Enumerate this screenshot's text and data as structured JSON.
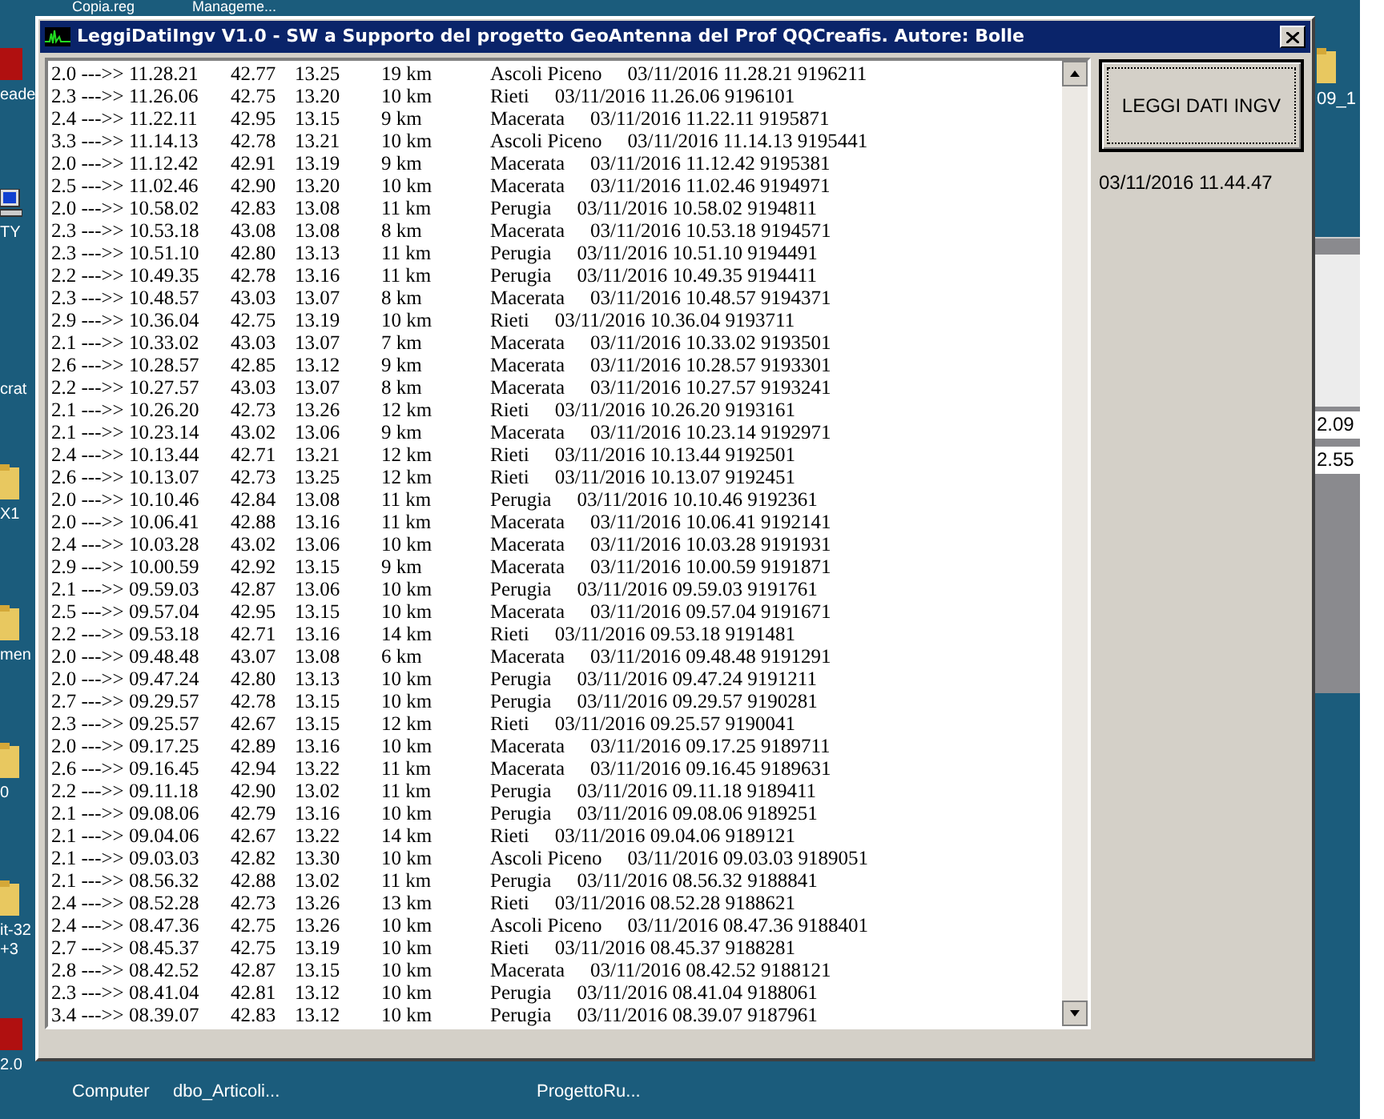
{
  "desktop": {
    "icons": [
      {
        "kind": "none",
        "label": "Copia.reg"
      },
      {
        "kind": "none",
        "label": "Manageme..."
      },
      {
        "kind": "app",
        "label": "eade"
      },
      {
        "kind": "computer",
        "label": "TY"
      },
      {
        "kind": "none",
        "label": "crat"
      },
      {
        "kind": "folder",
        "label": "X1"
      },
      {
        "kind": "folder",
        "label": "men"
      },
      {
        "kind": "folder",
        "label": "0"
      },
      {
        "kind": "folder",
        "label": "it-32\n+3"
      },
      {
        "kind": "app",
        "label": "2.0"
      },
      {
        "kind": "none",
        "label": "Computer"
      },
      {
        "kind": "none",
        "label": "dbo_Articoli..."
      },
      {
        "kind": "none",
        "label": "ProgettoRu..."
      },
      {
        "kind": "folder",
        "label": "09_1"
      }
    ]
  },
  "background_window": {
    "fields": [
      "2.09",
      "2.55"
    ]
  },
  "window": {
    "title": "LeggiDatiIngv V1.0 - SW a Supporto del progetto GeoAntenna del Prof QQCreafis.  Autore: Bolle",
    "rows": [
      {
        "event": "2.0 --->> 11.28.21",
        "lat": "42.77",
        "lon": "13.25",
        "depth": "19 km",
        "place": "Ascoli Piceno",
        "stamp": "03/11/2016 11.28.21 9196211"
      },
      {
        "event": "2.3 --->> 11.26.06",
        "lat": "42.75",
        "lon": "13.20",
        "depth": "10 km",
        "place": "Rieti",
        "stamp": "03/11/2016 11.26.06 9196101"
      },
      {
        "event": "2.4 --->> 11.22.11",
        "lat": "42.95",
        "lon": "13.15",
        "depth": "9 km",
        "place": "Macerata",
        "stamp": "03/11/2016 11.22.11 9195871"
      },
      {
        "event": "3.3 --->> 11.14.13",
        "lat": "42.78",
        "lon": "13.21",
        "depth": "10 km",
        "place": "Ascoli Piceno",
        "stamp": "03/11/2016 11.14.13 9195441"
      },
      {
        "event": "2.0 --->> 11.12.42",
        "lat": "42.91",
        "lon": "13.19",
        "depth": "9 km",
        "place": "Macerata",
        "stamp": "03/11/2016 11.12.42 9195381"
      },
      {
        "event": "2.5 --->> 11.02.46",
        "lat": "42.90",
        "lon": "13.20",
        "depth": "10 km",
        "place": "Macerata",
        "stamp": "03/11/2016 11.02.46 9194971"
      },
      {
        "event": "2.0 --->> 10.58.02",
        "lat": "42.83",
        "lon": "13.08",
        "depth": "11 km",
        "place": "Perugia",
        "stamp": "03/11/2016 10.58.02 9194811"
      },
      {
        "event": "2.3 --->> 10.53.18",
        "lat": "43.08",
        "lon": "13.08",
        "depth": "8 km",
        "place": "Macerata",
        "stamp": "03/11/2016 10.53.18 9194571"
      },
      {
        "event": "2.3 --->> 10.51.10",
        "lat": "42.80",
        "lon": "13.13",
        "depth": "11 km",
        "place": "Perugia",
        "stamp": "03/11/2016 10.51.10 9194491"
      },
      {
        "event": "2.2 --->> 10.49.35",
        "lat": "42.78",
        "lon": "13.16",
        "depth": "11 km",
        "place": "Perugia",
        "stamp": "03/11/2016 10.49.35 9194411"
      },
      {
        "event": "2.3 --->> 10.48.57",
        "lat": "43.03",
        "lon": "13.07",
        "depth": "8 km",
        "place": "Macerata",
        "stamp": "03/11/2016 10.48.57 9194371"
      },
      {
        "event": "2.9 --->> 10.36.04",
        "lat": "42.75",
        "lon": "13.19",
        "depth": "10 km",
        "place": "Rieti",
        "stamp": "03/11/2016 10.36.04 9193711"
      },
      {
        "event": "2.1 --->> 10.33.02",
        "lat": "43.03",
        "lon": "13.07",
        "depth": "7 km",
        "place": "Macerata",
        "stamp": "03/11/2016 10.33.02 9193501"
      },
      {
        "event": "2.6 --->> 10.28.57",
        "lat": "42.85",
        "lon": "13.12",
        "depth": "9 km",
        "place": "Macerata",
        "stamp": "03/11/2016 10.28.57 9193301"
      },
      {
        "event": "2.2 --->> 10.27.57",
        "lat": "43.03",
        "lon": "13.07",
        "depth": "8 km",
        "place": "Macerata",
        "stamp": "03/11/2016 10.27.57 9193241"
      },
      {
        "event": "2.1 --->> 10.26.20",
        "lat": "42.73",
        "lon": "13.26",
        "depth": "12 km",
        "place": "Rieti",
        "stamp": "03/11/2016 10.26.20 9193161"
      },
      {
        "event": "2.1 --->> 10.23.14",
        "lat": "43.02",
        "lon": "13.06",
        "depth": "9 km",
        "place": "Macerata",
        "stamp": "03/11/2016 10.23.14 9192971"
      },
      {
        "event": "2.4 --->> 10.13.44",
        "lat": "42.71",
        "lon": "13.21",
        "depth": "12 km",
        "place": "Rieti",
        "stamp": "03/11/2016 10.13.44 9192501"
      },
      {
        "event": "2.6 --->> 10.13.07",
        "lat": "42.73",
        "lon": "13.25",
        "depth": "12 km",
        "place": "Rieti",
        "stamp": "03/11/2016 10.13.07 9192451"
      },
      {
        "event": "2.0 --->> 10.10.46",
        "lat": "42.84",
        "lon": "13.08",
        "depth": "11 km",
        "place": "Perugia",
        "stamp": "03/11/2016 10.10.46 9192361"
      },
      {
        "event": "2.0 --->> 10.06.41",
        "lat": "42.88",
        "lon": "13.16",
        "depth": "11 km",
        "place": "Macerata",
        "stamp": "03/11/2016 10.06.41 9192141"
      },
      {
        "event": "2.4 --->> 10.03.28",
        "lat": "43.02",
        "lon": "13.06",
        "depth": "10 km",
        "place": "Macerata",
        "stamp": "03/11/2016 10.03.28 9191931"
      },
      {
        "event": "2.9 --->> 10.00.59",
        "lat": "42.92",
        "lon": "13.15",
        "depth": "9 km",
        "place": "Macerata",
        "stamp": "03/11/2016 10.00.59 9191871"
      },
      {
        "event": "2.1 --->> 09.59.03",
        "lat": "42.87",
        "lon": "13.06",
        "depth": "10 km",
        "place": "Perugia",
        "stamp": "03/11/2016 09.59.03 9191761"
      },
      {
        "event": "2.5 --->> 09.57.04",
        "lat": "42.95",
        "lon": "13.15",
        "depth": "10 km",
        "place": "Macerata",
        "stamp": "03/11/2016 09.57.04 9191671"
      },
      {
        "event": "2.2 --->> 09.53.18",
        "lat": "42.71",
        "lon": "13.16",
        "depth": "14 km",
        "place": "Rieti",
        "stamp": "03/11/2016 09.53.18 9191481"
      },
      {
        "event": "2.0 --->> 09.48.48",
        "lat": "43.07",
        "lon": "13.08",
        "depth": "6 km",
        "place": "Macerata",
        "stamp": "03/11/2016 09.48.48 9191291"
      },
      {
        "event": "2.0 --->> 09.47.24",
        "lat": "42.80",
        "lon": "13.13",
        "depth": "10 km",
        "place": "Perugia",
        "stamp": "03/11/2016 09.47.24 9191211"
      },
      {
        "event": "2.7 --->> 09.29.57",
        "lat": "42.78",
        "lon": "13.15",
        "depth": "10 km",
        "place": "Perugia",
        "stamp": "03/11/2016 09.29.57 9190281"
      },
      {
        "event": "2.3 --->> 09.25.57",
        "lat": "42.67",
        "lon": "13.15",
        "depth": "12 km",
        "place": "Rieti",
        "stamp": "03/11/2016 09.25.57 9190041"
      },
      {
        "event": "2.0 --->> 09.17.25",
        "lat": "42.89",
        "lon": "13.16",
        "depth": "10 km",
        "place": "Macerata",
        "stamp": "03/11/2016 09.17.25 9189711"
      },
      {
        "event": "2.6 --->> 09.16.45",
        "lat": "42.94",
        "lon": "13.22",
        "depth": "11 km",
        "place": "Macerata",
        "stamp": "03/11/2016 09.16.45 9189631"
      },
      {
        "event": "2.2 --->> 09.11.18",
        "lat": "42.90",
        "lon": "13.02",
        "depth": "11 km",
        "place": "Perugia",
        "stamp": "03/11/2016 09.11.18 9189411"
      },
      {
        "event": "2.1 --->> 09.08.06",
        "lat": "42.79",
        "lon": "13.16",
        "depth": "10 km",
        "place": "Perugia",
        "stamp": "03/11/2016 09.08.06 9189251"
      },
      {
        "event": "2.1 --->> 09.04.06",
        "lat": "42.67",
        "lon": "13.22",
        "depth": "14 km",
        "place": "Rieti",
        "stamp": "03/11/2016 09.04.06 9189121"
      },
      {
        "event": "2.1 --->> 09.03.03",
        "lat": "42.82",
        "lon": "13.30",
        "depth": "10 km",
        "place": "Ascoli Piceno",
        "stamp": "03/11/2016 09.03.03 9189051"
      },
      {
        "event": "2.1 --->> 08.56.32",
        "lat": "42.88",
        "lon": "13.02",
        "depth": "11 km",
        "place": "Perugia",
        "stamp": "03/11/2016 08.56.32 9188841"
      },
      {
        "event": "2.4 --->> 08.52.28",
        "lat": "42.73",
        "lon": "13.26",
        "depth": "13 km",
        "place": "Rieti",
        "stamp": "03/11/2016 08.52.28 9188621"
      },
      {
        "event": "2.4 --->> 08.47.36",
        "lat": "42.75",
        "lon": "13.26",
        "depth": "10 km",
        "place": "Ascoli Piceno",
        "stamp": "03/11/2016 08.47.36 9188401"
      },
      {
        "event": "2.7 --->> 08.45.37",
        "lat": "42.75",
        "lon": "13.19",
        "depth": "10 km",
        "place": "Rieti",
        "stamp": "03/11/2016 08.45.37 9188281"
      },
      {
        "event": "2.8 --->> 08.42.52",
        "lat": "42.87",
        "lon": "13.15",
        "depth": "10 km",
        "place": "Macerata",
        "stamp": "03/11/2016 08.42.52 9188121"
      },
      {
        "event": "2.3 --->> 08.41.04",
        "lat": "42.81",
        "lon": "13.12",
        "depth": "10 km",
        "place": "Perugia",
        "stamp": "03/11/2016 08.41.04 9188061"
      },
      {
        "event": "3.4 --->> 08.39.07",
        "lat": "42.83",
        "lon": "13.12",
        "depth": "10 km",
        "place": "Perugia",
        "stamp": "03/11/2016 08.39.07 9187961"
      }
    ],
    "button": "LEGGI DATI INGV",
    "timestamp": "03/11/2016 11.44.47"
  }
}
